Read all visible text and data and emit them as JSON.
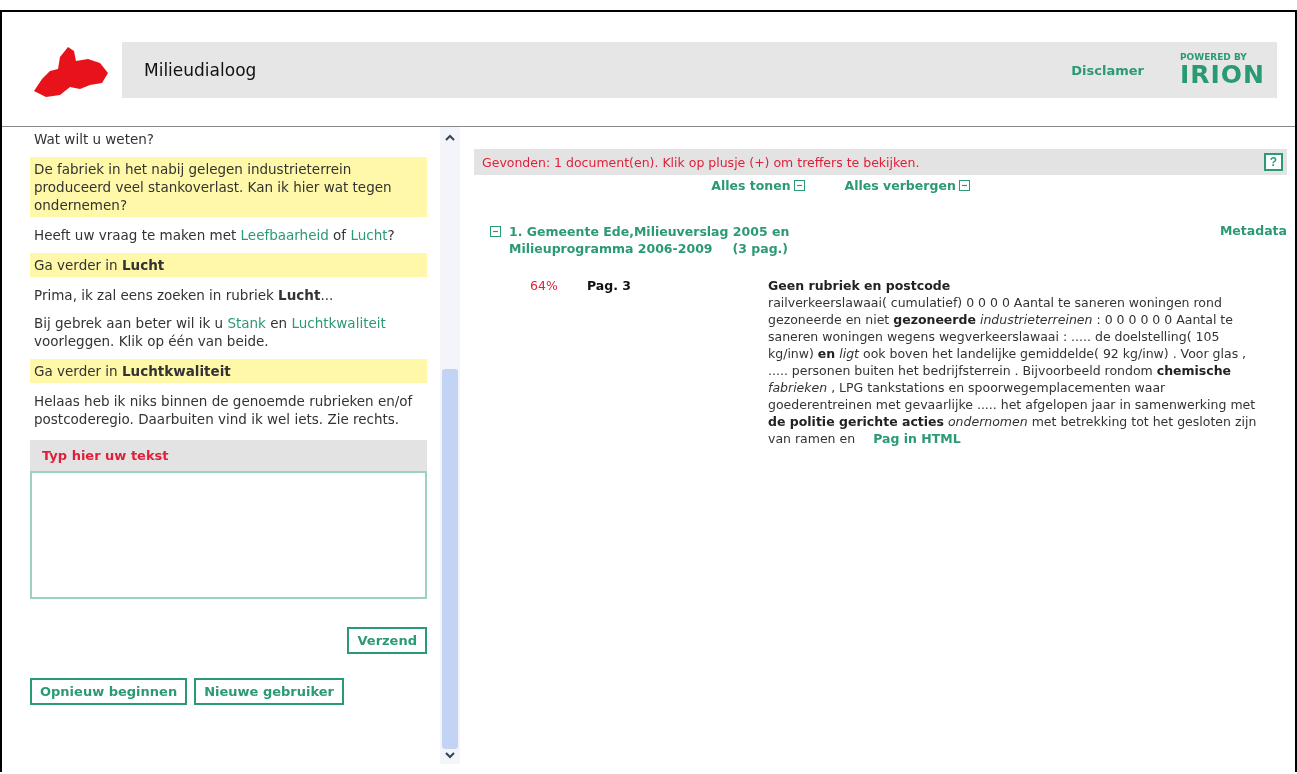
{
  "header": {
    "title": "Milieudialoog",
    "disclaimer": "Disclamer",
    "powered_by": "POWERED BY",
    "brand": "IRION"
  },
  "chat": {
    "messages": [
      {
        "kind": "system",
        "parts": [
          {
            "kind": "plain",
            "text": "Wat wilt u weten?"
          }
        ]
      },
      {
        "kind": "user",
        "parts": [
          {
            "kind": "plain",
            "text": "De fabriek in het nabij gelegen industrieterrein produceerd veel stankoverlast. Kan ik hier wat tegen ondernemen?"
          }
        ]
      },
      {
        "kind": "system",
        "parts": [
          {
            "kind": "plain",
            "text": "Heeft uw vraag te maken met "
          },
          {
            "kind": "link",
            "text": "Leefbaarheid"
          },
          {
            "kind": "plain",
            "text": " of "
          },
          {
            "kind": "link",
            "text": "Lucht"
          },
          {
            "kind": "plain",
            "text": "?"
          }
        ]
      },
      {
        "kind": "user",
        "parts": [
          {
            "kind": "plain",
            "text": "Ga verder in **Lucht**"
          }
        ]
      },
      {
        "kind": "system",
        "parts": [
          {
            "kind": "plain",
            "text": "Prima, ik zal eens zoeken in rubriek **Lucht**..."
          }
        ]
      },
      {
        "kind": "system",
        "parts": [
          {
            "kind": "plain",
            "text": "Bij gebrek aan beter wil ik u "
          },
          {
            "kind": "link",
            "text": "Stank"
          },
          {
            "kind": "plain",
            "text": " en "
          },
          {
            "kind": "link",
            "text": "Luchtkwaliteit"
          },
          {
            "kind": "plain",
            "text": " voorleggen. Klik op één van beide."
          }
        ]
      },
      {
        "kind": "user",
        "parts": [
          {
            "kind": "plain",
            "text": "Ga verder in **Luchtkwaliteit**"
          }
        ]
      },
      {
        "kind": "system",
        "parts": [
          {
            "kind": "plain",
            "text": "Helaas heb ik niks binnen de genoemde rubrieken en/of postcoderegio. Daarbuiten vind ik wel iets. Zie rechts."
          }
        ]
      }
    ],
    "input_label": "Typ hier uw tekst",
    "send_button": "Verzend",
    "buttons": [
      "Opnieuw beginnen",
      "Nieuwe gebruiker"
    ]
  },
  "results": {
    "summary": "Gevonden: 1 document(en). Klik op plusje (+) om treffers te bekijken.",
    "help": "?",
    "show_all": "Alles tonen",
    "hide_all": "Alles verbergen",
    "documents": [
      {
        "title": "1. Gemeente Ede,Milieuverslag 2005 en Milieuprogramma 2006-2009",
        "pages": "(3 pag.)",
        "expanded": true,
        "metadata": "Metadata",
        "hits": [
          {
            "score": "64%",
            "page": "Pag. 3",
            "heading": "Geen rubriek en postcode",
            "snippet": "railverkeerslawaai( cumulatief) 0 0 0 0 Aantal te saneren woningen rond gezoneerde en niet **gezoneerde** *industrieterreinen* : 0 0 0 0 0 0 Aantal te saneren woningen wegens wegverkeerslawaai : ..... de doelstelling( 105 kg/inw) **en** *ligt* ook boven het landelijke gemiddelde( 92 kg/inw) . Voor glas , ..... personen buiten het bedrijfsterrein . Bijvoorbeeld rondom **chemische** *fabrieken* , LPG tankstations en spoorwegemplacementen waar goederentreinen met gevaarlijke ..... het afgelopen jaar in samenwerking met **de politie gerichte acties** *ondernomen* met betrekking tot het gesloten zijn van ramen en",
            "link": "Pag in HTML"
          }
        ]
      }
    ]
  }
}
